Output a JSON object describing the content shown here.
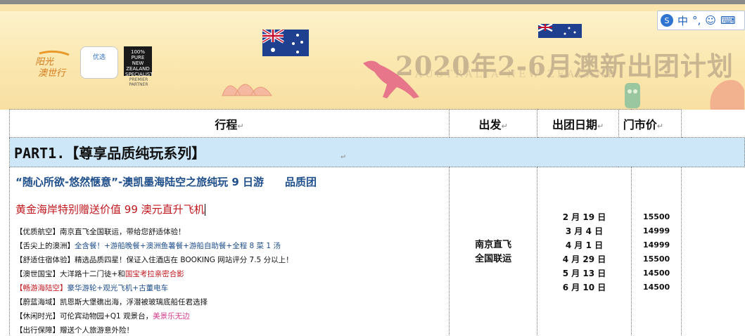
{
  "banner": {
    "title": "2020年2-6月澳新出团计划",
    "subtitle": "AUSTRALIA NEW ZEALAND",
    "logo_text": "阳光澳世行",
    "logo2_text": "优选",
    "logo3_text": "100% PURE NEW ZEALAND SPECIALIST",
    "logo3_sub": "PREMIER PARTNER"
  },
  "ime_toolbar": {
    "items": [
      "中",
      "°,",
      "☺",
      "⌨"
    ]
  },
  "table": {
    "headers": {
      "itinerary": "行程",
      "departure": "出发",
      "dates": "出团日期",
      "price": "门市价"
    },
    "part_title": "PART1.【尊享品质纯玩系列】",
    "trip": {
      "name": "“随心所欲-悠然惬意”-澳凯墨海陆空之旅纯玩 9 日游　　品质团",
      "promo": "黄金海岸特别赠送价值 99 澳元直升飞机",
      "highlights": [
        {
          "tag": "【优质航空】",
          "text": "南京直飞全国联运，带给您舒适体验！"
        },
        {
          "tag": "【舌尖上的澳洲】",
          "text": "全含餐！+游船晚餐+澳洲鱼薯餐+游船自助餐+全程 8 菜 1 汤"
        },
        {
          "tag": "【舒适住宿体验】",
          "text": "精选品质四星！保证入住酒店在 BOOKING 网站评分 7.5 分以上！"
        },
        {
          "tag": "【澳世国宝】",
          "text": "大洋路十二门徒+和",
          "extra": "国宝考拉亲密合影"
        },
        {
          "tag": "【畅游海陆空】",
          "text": "豪华游轮+观光飞机+古董电车"
        },
        {
          "tag": "【蔚蓝海域】",
          "text": "凯恩斯大堡礁出海，浮潜被玻璃底船任君选择"
        },
        {
          "tag": "【休闲时光】",
          "text": "可伦宾动物园+Q1 观景台，",
          "extra": "美景乐无边"
        },
        {
          "tag": "【出行保障】",
          "text": "赠送个人旅游意外险！"
        }
      ]
    },
    "departure": [
      "南京直飞",
      "全国联运"
    ],
    "dates": [
      "2 月 19 日",
      "3 月 4 日",
      "4 月 1 日",
      "4 月 29 日",
      "5 月 13 日",
      "6 月 10 日"
    ],
    "prices": [
      "15500",
      "14999",
      "14999",
      "15500",
      "14500",
      "14500"
    ],
    "paragraph_mark": "↵"
  }
}
